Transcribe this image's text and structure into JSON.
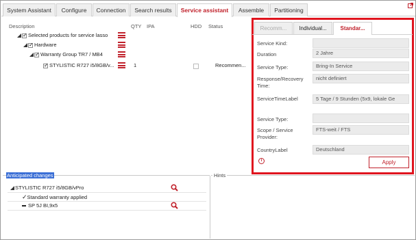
{
  "tabs": [
    {
      "label": "System Assistant",
      "active": false
    },
    {
      "label": "Configure",
      "active": false
    },
    {
      "label": "Connection",
      "active": false
    },
    {
      "label": "Search results",
      "active": false
    },
    {
      "label": "Service assistant",
      "active": true
    },
    {
      "label": "Assemble",
      "active": false
    },
    {
      "label": "Partitioning",
      "active": false
    }
  ],
  "grid": {
    "headers": {
      "description": "Description",
      "qty": "QTY",
      "ipa": "IPA",
      "hdd": "HDD",
      "status": "Status"
    },
    "rows": [
      {
        "label": "Selected products for service lasso",
        "checked": true
      },
      {
        "label": "Hardware",
        "checked": true
      },
      {
        "label": "Warranty Group TR7 / MB4",
        "checked": true
      },
      {
        "label": "STYLISTIC R727 i5/8GB/v...",
        "checked": true,
        "qty": "1",
        "status": "Recommen..."
      }
    ]
  },
  "panel": {
    "tabs": [
      {
        "label": "Recomm...",
        "state": "disabled"
      },
      {
        "label": "Individual...",
        "state": "normal"
      },
      {
        "label": "Standar...",
        "state": "active"
      }
    ],
    "fields": [
      {
        "label": "Service Kind:",
        "value": ""
      },
      {
        "label": "Duration",
        "value": "2 Jahre"
      },
      {
        "label": "Service Type:",
        "value": "Bring-In Service"
      },
      {
        "label": "Response/Recovery Time:",
        "value": "nicht definiert"
      },
      {
        "label": "ServiceTimeLabel",
        "value": "5 Tage / 9 Stunden (5x9, lokale Ge"
      },
      {
        "label": "Service Type:",
        "value": ""
      },
      {
        "label": "Scope / Service Provider:",
        "value": "FTS-weit / FTS"
      },
      {
        "label": "CountryLabel",
        "value": "Deutschland"
      }
    ],
    "info_glyph": "i",
    "apply_label": "Apply"
  },
  "anticipated": {
    "title": "Anticipated changes",
    "items": [
      {
        "label": "STYLISTIC R727 i5/8GB/vPro"
      },
      {
        "label": "Standard warranty applied"
      },
      {
        "label": "SP 5J BI,9x5"
      }
    ]
  },
  "hints": {
    "title": "Hints"
  },
  "colors": {
    "accent": "#c0202a",
    "highlight_border": "#e0141e",
    "selection": "#3b6fd6"
  },
  "icons": [
    "hamburger-menu-icon",
    "magnifier-icon",
    "external-link-icon",
    "info-icon",
    "tree-expand-icon",
    "checkmark-icon",
    "dash-icon"
  ]
}
